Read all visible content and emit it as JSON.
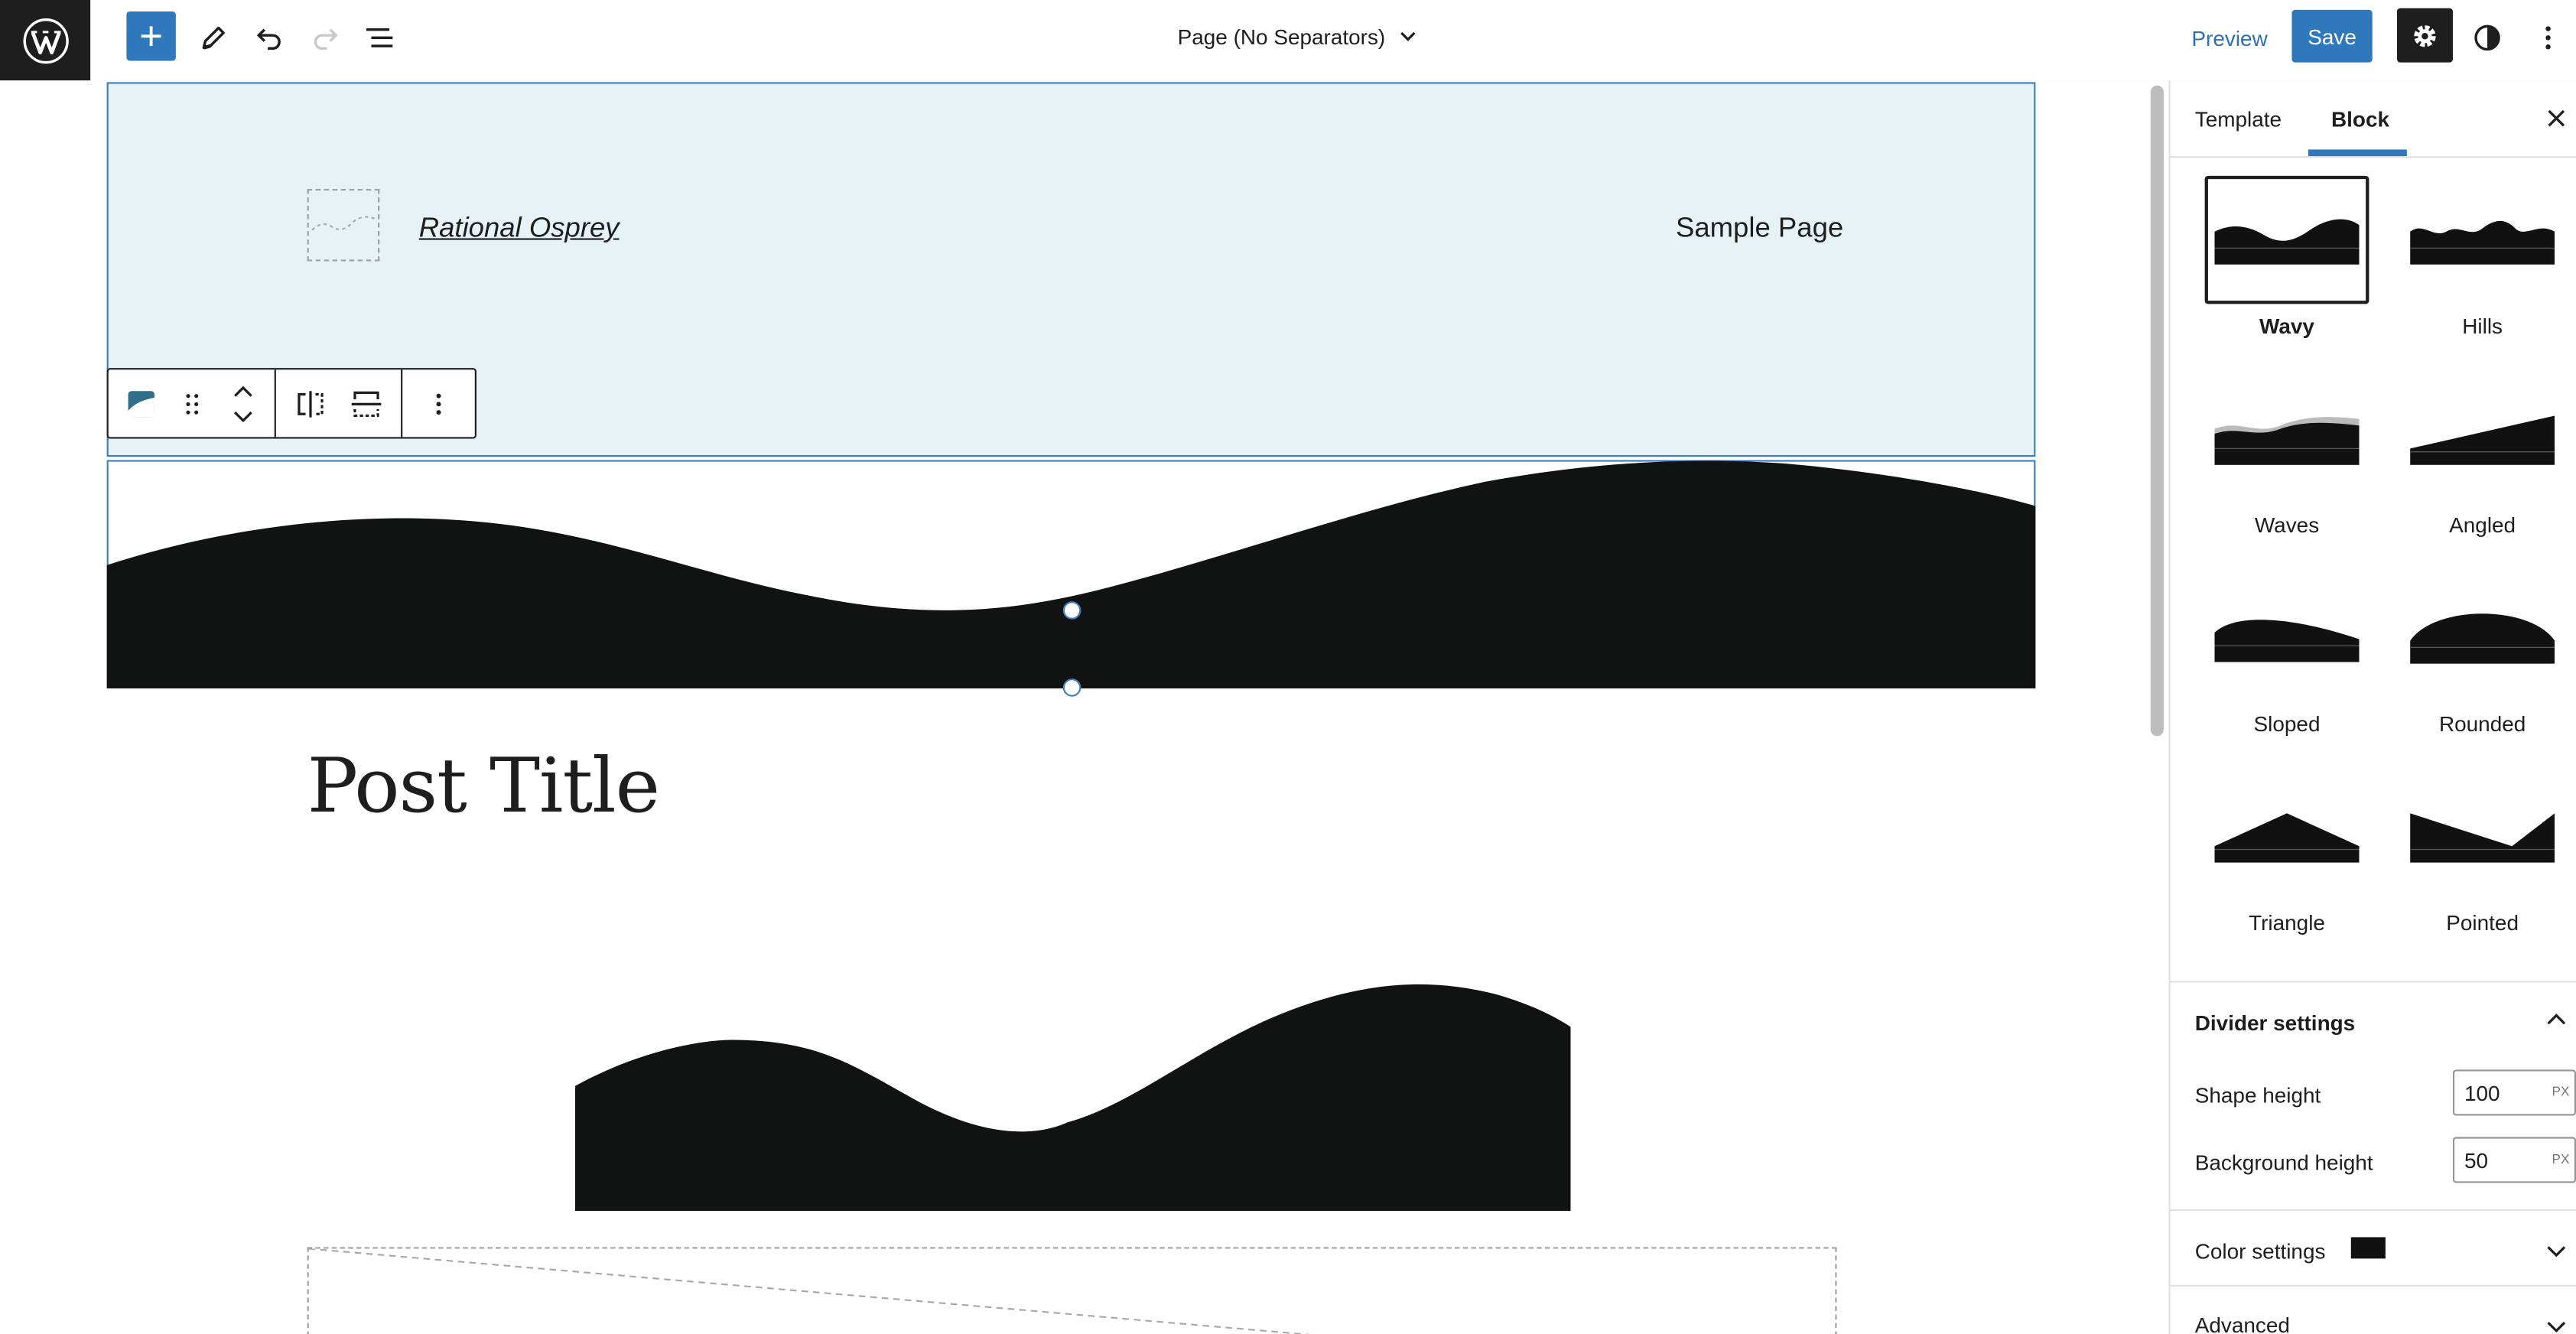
{
  "topbar": {
    "document_title": "Page (No Separators)",
    "preview_label": "Preview",
    "save_label": "Save"
  },
  "canvas": {
    "site_title": "Rational Osprey",
    "nav_link": "Sample Page",
    "post_title": "Post Title"
  },
  "sidebar": {
    "tabs": [
      {
        "label": "Template"
      },
      {
        "label": "Block"
      }
    ],
    "active_tab": "Block",
    "styles": [
      {
        "label": "Wavy",
        "selected": true
      },
      {
        "label": "Hills"
      },
      {
        "label": "Waves"
      },
      {
        "label": "Angled"
      },
      {
        "label": "Sloped"
      },
      {
        "label": "Rounded"
      },
      {
        "label": "Triangle"
      },
      {
        "label": "Pointed"
      }
    ],
    "divider_settings": {
      "title": "Divider settings",
      "shape_height_label": "Shape height",
      "shape_height_value": "100",
      "shape_height_unit": "PX",
      "background_height_label": "Background height",
      "background_height_value": "50",
      "background_height_unit": "PX"
    },
    "color_settings": {
      "title": "Color settings",
      "swatch_color": "#111111"
    },
    "advanced": {
      "title": "Advanced"
    }
  },
  "colors": {
    "accent": "#2f78bb",
    "header_bg": "#e6f2f5",
    "shape_fill": "#111212"
  }
}
